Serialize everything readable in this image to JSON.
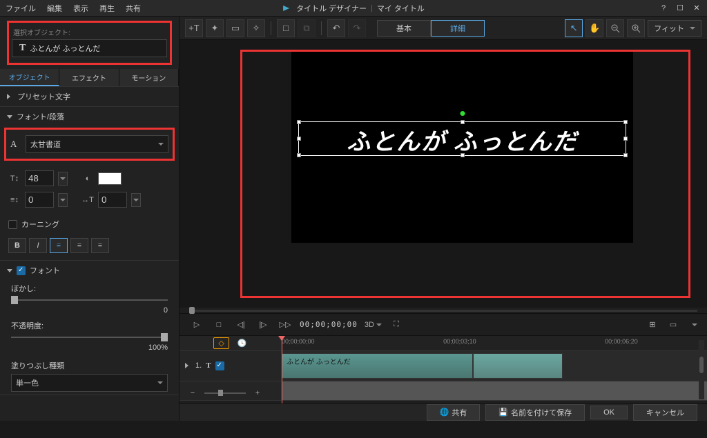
{
  "titlebar": {
    "menu": [
      "ファイル",
      "編集",
      "表示",
      "再生",
      "共有"
    ],
    "app": "タイトル デザイナー",
    "sep": "|",
    "doc": "マイ タイトル"
  },
  "selected_object": {
    "label": "選択オブジェクト:",
    "value": "ふとんが ふっとんだ"
  },
  "side_tabs": [
    "オブジェクト",
    "エフェクト",
    "モーション"
  ],
  "sec_preset": "プリセット文字",
  "sec_font": "フォント/段落",
  "font": {
    "name": "太甘書道",
    "size": "48",
    "lineh": "0",
    "tracking": "0",
    "kerning_label": "カーニング"
  },
  "sec_font2": "フォント",
  "blur": {
    "label": "ぼかし:",
    "value": "0"
  },
  "opacity": {
    "label": "不透明度:",
    "value": "100%"
  },
  "fill": {
    "label": "塗りつぶし種類",
    "value": "単一色"
  },
  "toolbar": {
    "mode_basic": "基本",
    "mode_adv": "詳細",
    "fit": "フィット"
  },
  "preview": {
    "title_text": "ふとんが ふっとんだ"
  },
  "playback": {
    "timecode": "00;00;00;00",
    "threed": "3D"
  },
  "timeline": {
    "marks": [
      "00;00;00;00",
      "00;00;03;10",
      "00;00;06;20"
    ],
    "track_no": "1.",
    "clip_label": "ふとんが ふっとんだ"
  },
  "footer": {
    "share": "共有",
    "saveas": "名前を付けて保存",
    "ok": "OK",
    "cancel": "キャンセル"
  }
}
